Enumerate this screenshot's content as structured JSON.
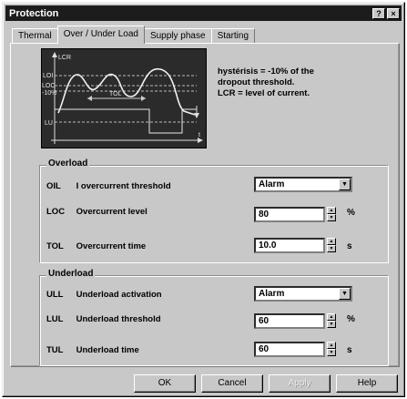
{
  "window": {
    "title": "Protection"
  },
  "title_buttons": {
    "help": "?",
    "close": "×"
  },
  "tabs": [
    {
      "label": "Thermal"
    },
    {
      "label": "Over / Under Load"
    },
    {
      "label": "Supply phase"
    },
    {
      "label": "Starting"
    }
  ],
  "diagram": {
    "labels": {
      "lcr": "LCR",
      "loi": "LOI",
      "loc": "LOC",
      "pct": "-10%",
      "tol": "TOL",
      "lu": "LU",
      "t": "t"
    }
  },
  "note": {
    "line1": "hystérisis = -10% of the",
    "line2": "dropout threshold.",
    "line3": "LCR = level of current."
  },
  "overload": {
    "title": "Overload",
    "oil": {
      "code": "OIL",
      "label": "I overcurrent threshold",
      "value": "Alarm"
    },
    "loc": {
      "code": "LOC",
      "label": "Overcurrent level",
      "value": "80",
      "unit": "%"
    },
    "tol": {
      "code": "TOL",
      "label": "Overcurrent time",
      "value": "10.0",
      "unit": "s"
    }
  },
  "underload": {
    "title": "Underload",
    "ull": {
      "code": "ULL",
      "label": "Underload activation",
      "value": "Alarm"
    },
    "lul": {
      "code": "LUL",
      "label": "Underload threshold",
      "value": "60",
      "unit": "%"
    },
    "tul": {
      "code": "TUL",
      "label": "Underload time",
      "value": "60",
      "unit": "s"
    }
  },
  "buttons": {
    "ok": "OK",
    "cancel": "Cancel",
    "apply": "Apply",
    "help": "Help"
  }
}
